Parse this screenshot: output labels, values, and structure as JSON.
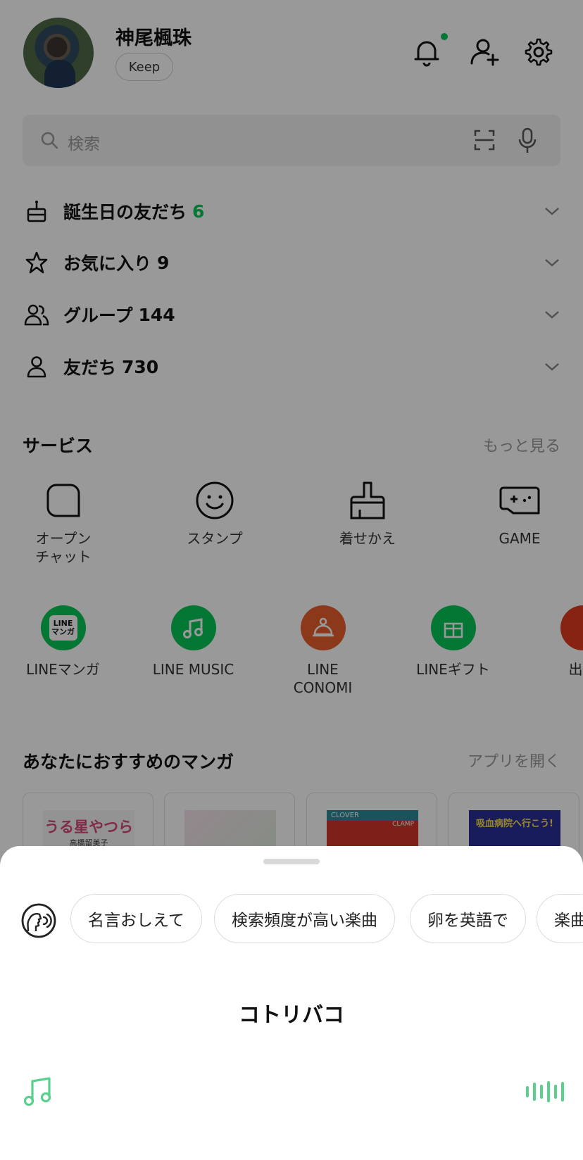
{
  "profile": {
    "name": "神尾楓珠",
    "keep_label": "Keep"
  },
  "header_icons": [
    "bell-icon",
    "add-friend-icon",
    "gear-icon"
  ],
  "search": {
    "placeholder": "検索"
  },
  "friends": {
    "birthday": {
      "label": "誕生日の友だち",
      "count": "6"
    },
    "favorites": {
      "label": "お気に入り",
      "count": "9"
    },
    "groups": {
      "label": "グループ",
      "count": "144"
    },
    "friends": {
      "label": "友だち",
      "count": "730"
    }
  },
  "services": {
    "title": "サービス",
    "more": "もっと見る",
    "items": [
      {
        "label": "オープン\nチャット",
        "icon": "open-chat-icon"
      },
      {
        "label": "スタンプ",
        "icon": "smiley-icon"
      },
      {
        "label": "着せかえ",
        "icon": "brush-icon"
      },
      {
        "label": "GAME",
        "icon": "gamepad-icon"
      }
    ],
    "apps": [
      {
        "label": "LINEマンガ",
        "badge": "LINE\nマンガ",
        "color": "#06c755"
      },
      {
        "label": "LINE MUSIC",
        "color": "#06c755"
      },
      {
        "label": "LINE\nCONOMI",
        "color": "#e8602c"
      },
      {
        "label": "LINEギフト",
        "color": "#06c755"
      },
      {
        "label": "出前",
        "color": "#e23b1e"
      }
    ]
  },
  "manga": {
    "title": "あなたにおすすめのマンガ",
    "open_app": "アプリを開く",
    "covers": [
      {
        "title": "うる星やつら",
        "author": "高橋留美子"
      },
      {
        "title": ""
      },
      {
        "title": "CLOVER",
        "sub": "CLAMP"
      },
      {
        "title": "吸血病院へ行こう!"
      }
    ]
  },
  "assistant": {
    "chips": [
      "名言おしえて",
      "検索頻度が高い楽曲",
      "卵を英語で",
      "楽曲"
    ],
    "result": "コトリバコ"
  }
}
